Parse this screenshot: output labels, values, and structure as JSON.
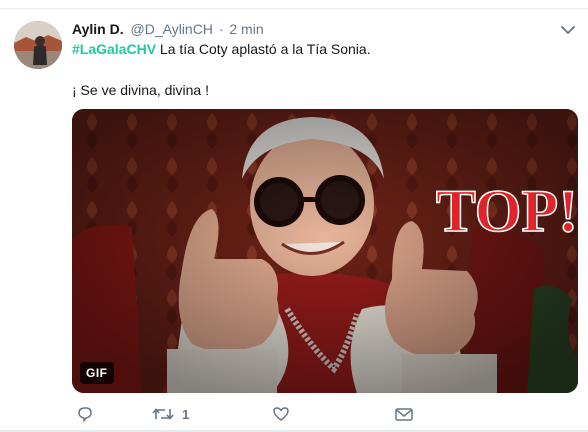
{
  "tweet": {
    "display_name": "Aylin D.",
    "handle": "@D_AylinCH",
    "separator": "·",
    "time": "2 min",
    "hashtag": "#LaGalaCHV",
    "text_after_hashtag": " La tía Coty aplastó a la Tía Sonia.",
    "line2": "¡ Se ve divina, divina !"
  },
  "media": {
    "overlay_text": "TOP!",
    "badge": "GIF"
  },
  "actions": {
    "reply_icon": "reply-icon",
    "retweet_icon": "retweet-icon",
    "retweet_count": "1",
    "like_icon": "heart-icon",
    "dm_icon": "envelope-icon"
  },
  "colors": {
    "hashtag": "#1dcaa0",
    "secondary_text": "#657786",
    "top_text": "#e0242b"
  }
}
